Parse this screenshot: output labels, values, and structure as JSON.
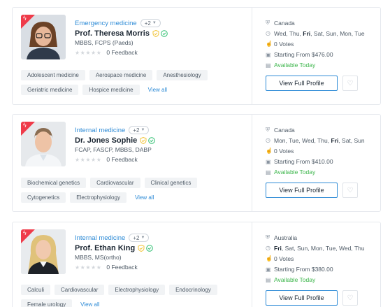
{
  "colors": {
    "accent": "#2e8bd6",
    "flag": "#ef3b4a",
    "available": "#3bb54a",
    "verified": "#2fbf71",
    "shield": "#f2c438"
  },
  "common": {
    "feedback_label": "0 Feedback",
    "view_all": "View all",
    "view_profile": "View Full Profile",
    "votes": "0 Votes",
    "available": "Available Today"
  },
  "doctors": [
    {
      "specialty": "Emergency medicine",
      "more_count": "+2",
      "name": "Prof. Theresa Morris",
      "qualifications": "MBBS, FCPS (Paeds)",
      "location": "Canada",
      "days_before": "Wed, Thu, ",
      "days_bold": "Fri",
      "days_after": ", Sat, Sun, Mon, Tue",
      "price": "Starting From $476.00",
      "tags": [
        "Adolescent medicine",
        "Aerospace medicine",
        "Anesthesiology",
        "Geriatric medicine",
        "Hospice medicine"
      ]
    },
    {
      "specialty": "Internal medicine",
      "more_count": "+2",
      "name": "Dr. Jones Sophie",
      "qualifications": "FCAP, FASCP, MBBS, DABP",
      "location": "Canada",
      "days_before": "Mon, Tue, Wed, Thu, ",
      "days_bold": "Fri",
      "days_after": ", Sat, Sun",
      "price": "Starting From $410.00",
      "tags": [
        "Biochemical genetics",
        "Cardiovascular",
        "Clinical genetics",
        "Cytogenetics",
        "Electrophysiology"
      ]
    },
    {
      "specialty": "Internal medicine",
      "more_count": "+2",
      "name": "Prof. Ethan King",
      "qualifications": "MBBS, MS(ortho)",
      "location": "Australia",
      "days_before": "",
      "days_bold": "Fri",
      "days_after": ", Sat, Sun, Mon, Tue, Wed, Thu",
      "price": "Starting From $380.00",
      "tags": [
        "Calculi",
        "Cardiovascular",
        "Electrophysiology",
        "Endocrinology",
        "Female urology"
      ]
    }
  ]
}
